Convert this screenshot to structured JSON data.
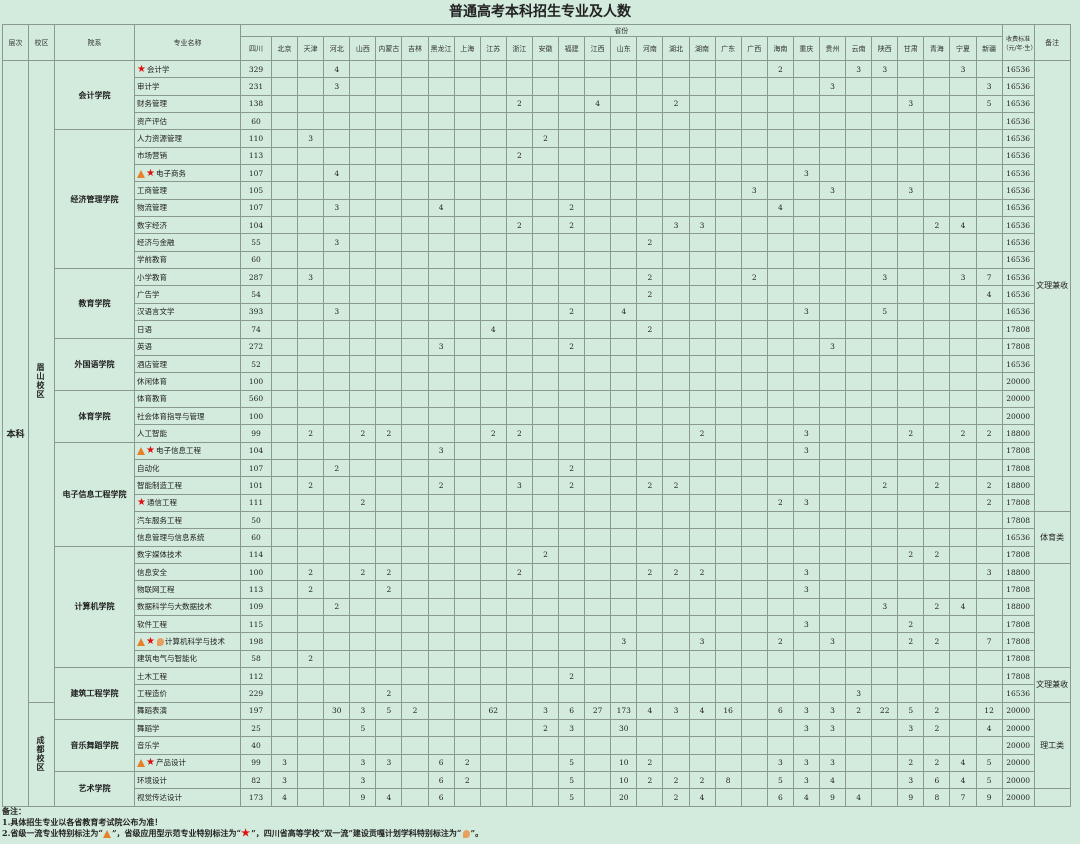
{
  "title": "普通高考本科招生专业及人数",
  "headers": {
    "level": "层次",
    "campus": "校区",
    "college": "院系",
    "major": "专业名称",
    "province_group": "省份",
    "fee": "收费标准（元/年·生）",
    "remark": "备注"
  },
  "provinces": [
    "四川",
    "北京",
    "天津",
    "河北",
    "山西",
    "内蒙古",
    "吉林",
    "黑龙江",
    "上海",
    "江苏",
    "浙江",
    "安徽",
    "福建",
    "江西",
    "山东",
    "河南",
    "湖北",
    "湖南",
    "广东",
    "广西",
    "海南",
    "重庆",
    "贵州",
    "云南",
    "陕西",
    "甘肃",
    "青海",
    "宁夏",
    "新疆"
  ],
  "level": "本科",
  "campuses": [
    {
      "name": "眉山校区",
      "span": 37
    },
    {
      "name": "成都校区",
      "span": 9
    }
  ],
  "colleges": [
    {
      "name": "会计学院",
      "span": 4
    },
    {
      "name": "经济管理学院",
      "span": 8
    },
    {
      "name": "教育学院",
      "span": 4
    },
    {
      "name": "外国语学院",
      "span": 3
    },
    {
      "name": "体育学院",
      "span": 3
    },
    {
      "name": "电子信息工程学院",
      "span": 6
    },
    {
      "name": "计算机学院",
      "span": 7
    },
    {
      "name": "建筑工程学院",
      "span": 3
    },
    {
      "name": "音乐舞蹈学院",
      "span": 3
    },
    {
      "name": "艺术学院",
      "span": 3
    }
  ],
  "remarks": [
    {
      "text": "文理兼收",
      "span": 26
    },
    {
      "text": "体育类",
      "span": 3
    },
    {
      "text": "",
      "span": 6
    },
    {
      "text": "文理兼收",
      "span": 2
    },
    {
      "text": "理工类",
      "span": 5
    },
    {
      "text": "",
      "span": 2
    },
    {
      "text": "文理兼收",
      "span": 1
    },
    {
      "text": "艺术类",
      "span": 6
    }
  ],
  "rows": [
    {
      "major": "会计学",
      "marks": [
        "star"
      ],
      "c": {
        "0": "329",
        "3": "4",
        "20": "2",
        "23": "3",
        "24": "3",
        "27": "3"
      },
      "fee": "16536"
    },
    {
      "major": "审计学",
      "marks": [],
      "c": {
        "0": "231",
        "3": "3",
        "22": "3",
        "28": "3"
      },
      "fee": "16536"
    },
    {
      "major": "财务管理",
      "marks": [],
      "c": {
        "0": "138",
        "10": "2",
        "13": "4",
        "16": "2",
        "25": "3",
        "28": "5"
      },
      "fee": "16536"
    },
    {
      "major": "资产评估",
      "marks": [],
      "c": {
        "0": "60"
      },
      "fee": "16536"
    },
    {
      "major": "人力资源管理",
      "marks": [],
      "c": {
        "0": "110",
        "2": "3",
        "11": "2"
      },
      "fee": "16536"
    },
    {
      "major": "市场营销",
      "marks": [],
      "c": {
        "0": "113",
        "10": "2"
      },
      "fee": "16536"
    },
    {
      "major": "电子商务",
      "marks": [
        "tri",
        "star"
      ],
      "c": {
        "0": "107",
        "3": "4",
        "21": "3"
      },
      "fee": "16536"
    },
    {
      "major": "工商管理",
      "marks": [],
      "c": {
        "0": "105",
        "19": "3",
        "22": "3",
        "25": "3"
      },
      "fee": "16536"
    },
    {
      "major": "物流管理",
      "marks": [],
      "c": {
        "0": "107",
        "3": "3",
        "7": "4",
        "12": "2",
        "20": "4"
      },
      "fee": "16536"
    },
    {
      "major": "数字经济",
      "marks": [],
      "c": {
        "0": "104",
        "10": "2",
        "12": "2",
        "16": "3",
        "17": "3",
        "26": "2",
        "27": "4"
      },
      "fee": "16536"
    },
    {
      "major": "经济与金融",
      "marks": [],
      "c": {
        "0": "55",
        "3": "3",
        "15": "2"
      },
      "fee": "16536"
    },
    {
      "major": "学前教育",
      "marks": [],
      "c": {
        "0": "60"
      },
      "fee": "16536"
    },
    {
      "major": "小学教育",
      "marks": [],
      "c": {
        "0": "287",
        "2": "3",
        "15": "2",
        "19": "2",
        "24": "3",
        "27": "3",
        "28": "7"
      },
      "fee": "16536"
    },
    {
      "major": "广告学",
      "marks": [],
      "c": {
        "0": "54",
        "15": "2",
        "28": "4"
      },
      "fee": "16536"
    },
    {
      "major": "汉语言文学",
      "marks": [],
      "c": {
        "0": "393",
        "3": "3",
        "12": "2",
        "14": "4",
        "21": "3",
        "24": "5"
      },
      "fee": "16536"
    },
    {
      "major": "日语",
      "marks": [],
      "c": {
        "0": "74",
        "9": "4",
        "15": "2"
      },
      "fee": "17808"
    },
    {
      "major": "英语",
      "marks": [],
      "c": {
        "0": "272",
        "7": "3",
        "12": "2",
        "22": "3"
      },
      "fee": "17808"
    },
    {
      "major": "酒店管理",
      "marks": [],
      "c": {
        "0": "52"
      },
      "fee": "16536"
    },
    {
      "major": "休闲体育",
      "marks": [],
      "c": {
        "0": "100"
      },
      "fee": "20000"
    },
    {
      "major": "体育教育",
      "marks": [],
      "c": {
        "0": "560"
      },
      "fee": "20000"
    },
    {
      "major": "社会体育指导与管理",
      "marks": [],
      "c": {
        "0": "100"
      },
      "fee": "20000"
    },
    {
      "major": "人工智能",
      "marks": [],
      "c": {
        "0": "99",
        "2": "2",
        "4": "2",
        "5": "2",
        "9": "2",
        "10": "2",
        "17": "2",
        "21": "3",
        "25": "2",
        "27": "2",
        "28": "2"
      },
      "fee": "18800"
    },
    {
      "major": "电子信息工程",
      "marks": [
        "tri",
        "star"
      ],
      "c": {
        "0": "104",
        "7": "3",
        "21": "3"
      },
      "fee": "17808"
    },
    {
      "major": "自动化",
      "marks": [],
      "c": {
        "0": "107",
        "3": "2",
        "12": "2"
      },
      "fee": "17808"
    },
    {
      "major": "智能制造工程",
      "marks": [],
      "c": {
        "0": "101",
        "2": "2",
        "7": "2",
        "10": "3",
        "12": "2",
        "15": "2",
        "16": "2",
        "24": "2",
        "26": "2",
        "28": "2"
      },
      "fee": "18800"
    },
    {
      "major": "通信工程",
      "marks": [
        "star"
      ],
      "c": {
        "0": "111",
        "4": "2",
        "20": "2",
        "21": "3",
        "28": "2"
      },
      "fee": "17808"
    },
    {
      "major": "汽车服务工程",
      "marks": [],
      "c": {
        "0": "50"
      },
      "fee": "17808"
    },
    {
      "major": "信息管理与信息系统",
      "marks": [],
      "c": {
        "0": "60"
      },
      "fee": "16536"
    },
    {
      "major": "数字媒体技术",
      "marks": [],
      "c": {
        "0": "114",
        "11": "2",
        "25": "2",
        "26": "2"
      },
      "fee": "17808"
    },
    {
      "major": "信息安全",
      "marks": [],
      "c": {
        "0": "100",
        "2": "2",
        "4": "2",
        "5": "2",
        "10": "2",
        "15": "2",
        "16": "2",
        "17": "2",
        "21": "3",
        "28": "3"
      },
      "fee": "18800"
    },
    {
      "major": "物联网工程",
      "marks": [],
      "c": {
        "0": "113",
        "2": "2",
        "5": "2",
        "21": "3"
      },
      "fee": "17808"
    },
    {
      "major": "数据科学与大数据技术",
      "marks": [],
      "c": {
        "0": "109",
        "3": "2",
        "24": "3",
        "26": "2",
        "27": "4"
      },
      "fee": "18800"
    },
    {
      "major": "软件工程",
      "marks": [],
      "c": {
        "0": "115",
        "21": "3",
        "25": "2"
      },
      "fee": "17808"
    },
    {
      "major": "计算机科学与技术",
      "marks": [
        "tri",
        "star",
        "drop"
      ],
      "c": {
        "0": "198",
        "14": "3",
        "17": "3",
        "20": "2",
        "22": "3",
        "25": "2",
        "26": "2",
        "28": "7"
      },
      "fee": "17808"
    },
    {
      "major": "建筑电气与智能化",
      "marks": [],
      "c": {
        "0": "58",
        "2": "2"
      },
      "fee": "17808"
    },
    {
      "major": "土木工程",
      "marks": [],
      "c": {
        "0": "112",
        "12": "2"
      },
      "fee": "17808"
    },
    {
      "major": "工程造价",
      "marks": [],
      "c": {
        "0": "229",
        "5": "2",
        "23": "3"
      },
      "fee": "16536"
    },
    {
      "major": "舞蹈表演",
      "marks": [],
      "c": {
        "0": "197",
        "3": "30",
        "4": "3",
        "5": "5",
        "6": "2",
        "9": "62",
        "11": "3",
        "12": "6",
        "13": "27",
        "14": "173",
        "15": "4",
        "16": "3",
        "17": "4",
        "18": "16",
        "20": "6",
        "21": "3",
        "22": "3",
        "23": "2",
        "24": "22",
        "25": "5",
        "26": "2",
        "28": "12"
      },
      "fee": "20000"
    },
    {
      "major": "舞蹈学",
      "marks": [],
      "c": {
        "0": "25",
        "4": "5",
        "11": "2",
        "12": "3",
        "14": "30",
        "21": "3",
        "22": "3",
        "25": "3",
        "26": "2",
        "28": "4"
      },
      "fee": "20000"
    },
    {
      "major": "音乐学",
      "marks": [],
      "c": {
        "0": "40"
      },
      "fee": "20000"
    },
    {
      "major": "产品设计",
      "marks": [
        "tri",
        "star"
      ],
      "c": {
        "0": "99",
        "1": "3",
        "4": "3",
        "5": "3",
        "7": "6",
        "8": "2",
        "12": "5",
        "14": "10",
        "15": "2",
        "20": "3",
        "21": "3",
        "22": "3",
        "25": "2",
        "26": "2",
        "27": "4",
        "28": "5"
      },
      "fee": "20000"
    },
    {
      "major": "环境设计",
      "marks": [],
      "c": {
        "0": "82",
        "1": "3",
        "4": "3",
        "7": "6",
        "8": "2",
        "12": "5",
        "14": "10",
        "15": "2",
        "16": "2",
        "17": "2",
        "18": "8",
        "20": "5",
        "21": "3",
        "22": "4",
        "25": "3",
        "26": "6",
        "27": "4",
        "28": "5"
      },
      "fee": "20000"
    },
    {
      "major": "视觉传达设计",
      "marks": [],
      "c": {
        "0": "173",
        "1": "4",
        "4": "9",
        "5": "4",
        "7": "6",
        "12": "5",
        "14": "20",
        "16": "2",
        "17": "4",
        "20": "6",
        "21": "4",
        "22": "9",
        "23": "4",
        "25": "9",
        "26": "8",
        "27": "7",
        "28": "9"
      },
      "fee": "20000"
    }
  ],
  "notes": {
    "heading": "备注：",
    "line1": "1.具体招生专业以各省教育考试院公布为准！",
    "line2a": "2.省级一流专业特别标注为“",
    "line2b": "”，省级应用型示范专业特别标注为“",
    "line2c": "”，四川省高等学校“双一流”建设贡嘎计划学科特别标注为“",
    "line2d": "”。"
  }
}
